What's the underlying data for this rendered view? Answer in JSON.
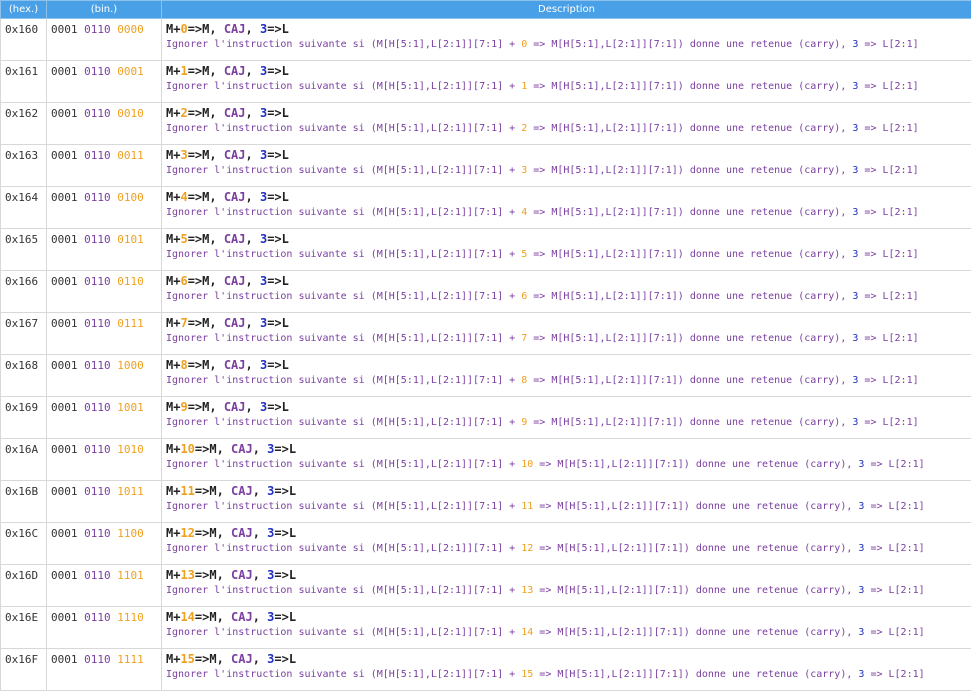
{
  "header": {
    "hex": "(hex.)",
    "bin": "(bin.)",
    "desc": "Description"
  },
  "text": {
    "m_plus": "M+",
    "to_m": "=>M, ",
    "caj": "CAJ",
    "comma": ", ",
    "three": "3",
    "to_l": "=>L",
    "ignore": "Ignorer l'instruction suivante si (M[H[5:1],L[2:1]][7:1] ",
    "plus": "+",
    "yields": " => M[H[5:1],L[2:1]][7:1]) donne une retenue (carry), ",
    "three_small": "3",
    "tail": " => L[2:1]"
  },
  "rows": [
    {
      "hex": "0x160",
      "b0": "0001",
      "b1": "0110",
      "b2": "0000",
      "n": "0"
    },
    {
      "hex": "0x161",
      "b0": "0001",
      "b1": "0110",
      "b2": "0001",
      "n": "1"
    },
    {
      "hex": "0x162",
      "b0": "0001",
      "b1": "0110",
      "b2": "0010",
      "n": "2"
    },
    {
      "hex": "0x163",
      "b0": "0001",
      "b1": "0110",
      "b2": "0011",
      "n": "3"
    },
    {
      "hex": "0x164",
      "b0": "0001",
      "b1": "0110",
      "b2": "0100",
      "n": "4"
    },
    {
      "hex": "0x165",
      "b0": "0001",
      "b1": "0110",
      "b2": "0101",
      "n": "5"
    },
    {
      "hex": "0x166",
      "b0": "0001",
      "b1": "0110",
      "b2": "0110",
      "n": "6"
    },
    {
      "hex": "0x167",
      "b0": "0001",
      "b1": "0110",
      "b2": "0111",
      "n": "7"
    },
    {
      "hex": "0x168",
      "b0": "0001",
      "b1": "0110",
      "b2": "1000",
      "n": "8"
    },
    {
      "hex": "0x169",
      "b0": "0001",
      "b1": "0110",
      "b2": "1001",
      "n": "9"
    },
    {
      "hex": "0x16A",
      "b0": "0001",
      "b1": "0110",
      "b2": "1010",
      "n": "10"
    },
    {
      "hex": "0x16B",
      "b0": "0001",
      "b1": "0110",
      "b2": "1011",
      "n": "11"
    },
    {
      "hex": "0x16C",
      "b0": "0001",
      "b1": "0110",
      "b2": "1100",
      "n": "12"
    },
    {
      "hex": "0x16D",
      "b0": "0001",
      "b1": "0110",
      "b2": "1101",
      "n": "13"
    },
    {
      "hex": "0x16E",
      "b0": "0001",
      "b1": "0110",
      "b2": "1110",
      "n": "14"
    },
    {
      "hex": "0x16F",
      "b0": "0001",
      "b1": "0110",
      "b2": "1111",
      "n": "15"
    }
  ]
}
